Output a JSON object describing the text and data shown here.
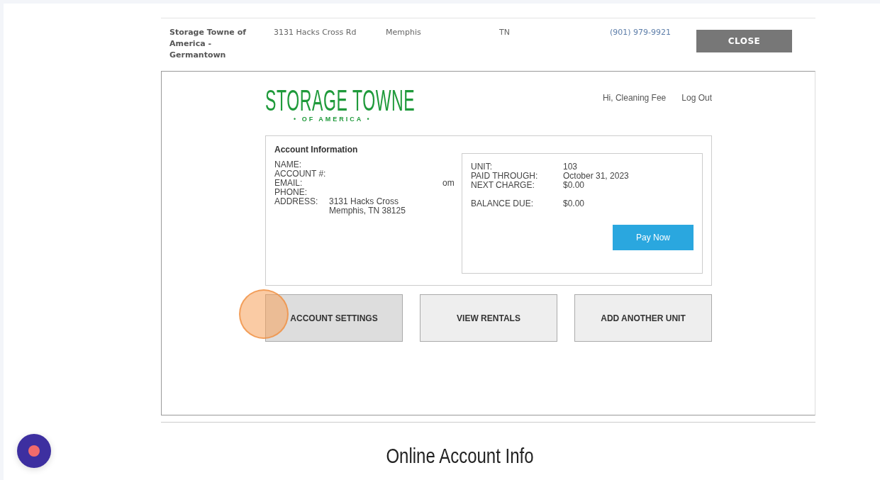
{
  "location_row": {
    "name": "Storage Towne of America - Germantown",
    "address": "3131 Hacks Cross Rd",
    "city": "Memphis",
    "state": "TN",
    "phone": "(901) 979-9921",
    "close_button": "CLOSE"
  },
  "portal": {
    "logo": {
      "main": "STORAGE TOWNE",
      "sub": "• OF AMERICA •"
    },
    "greeting": "Hi, Cleaning Fee",
    "logout": "Log Out",
    "account": {
      "heading": "Account Information",
      "fields": [
        {
          "label": "NAME:"
        },
        {
          "label": "ACCOUNT #:"
        },
        {
          "label": "EMAIL:",
          "value": "om"
        },
        {
          "label": "PHONE:"
        },
        {
          "label": "ADDRESS:",
          "value": "3131 Hacks Cross",
          "value2": "Memphis, TN 38125"
        }
      ]
    },
    "unit": {
      "rows": [
        {
          "label": "UNIT:",
          "value": "103"
        },
        {
          "label": "PAID THROUGH:",
          "value": "October 31, 2023"
        },
        {
          "label": "NEXT CHARGE:",
          "value": "$0.00"
        },
        {
          "label": "BALANCE DUE:",
          "value": "$0.00"
        }
      ],
      "pay_button": "Pay Now"
    },
    "actions": [
      {
        "label": "ACCOUNT SETTINGS",
        "selected": true
      },
      {
        "label": "VIEW RENTALS",
        "selected": false
      },
      {
        "label": "ADD ANOTHER UNIT",
        "selected": false
      }
    ]
  },
  "step_title": "Online Account Info"
}
